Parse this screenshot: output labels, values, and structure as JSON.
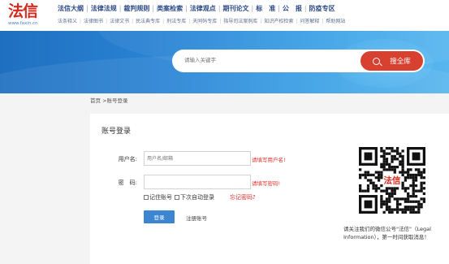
{
  "brand": {
    "logo": "法信",
    "url": "www.faxin.cn",
    "color": "#d42a1e"
  },
  "nav_primary": [
    "法信大纲",
    "法律法规",
    "裁判规则",
    "类案检索",
    "法律观点",
    "期刊论文",
    "标　准",
    "公　报",
    "防疫专区"
  ],
  "nav_secondary": [
    "法条释义",
    "法律图书",
    "法律文书",
    "民法典专库",
    "刑法专库",
    "天同码专库",
    "指导司法案例库",
    "知识产权检索",
    "问答解释",
    "帮助网站"
  ],
  "search": {
    "placeholder": "请输入关键字",
    "button": "搜全库",
    "button_color": "#d8402f"
  },
  "breadcrumb": "首页 >账号登录",
  "login": {
    "title": "账号登录",
    "username_label": "用户名:",
    "username_placeholder": "用户名/邮箱",
    "username_hint": "请填写用户名!",
    "password_label": "密　码:",
    "password_hint": "请填写密码!",
    "remember": "记住账号",
    "auto_login": "下次自动登录",
    "forgot": "忘记密码?",
    "submit": "登录",
    "register": "注册账号",
    "accent": "#3c86d1",
    "error_color": "#e0302a"
  },
  "qr": {
    "center_label": "法信",
    "caption": "请关注我们的微信公号\"法信\"（Legal Information），第一时间获取消息！"
  }
}
